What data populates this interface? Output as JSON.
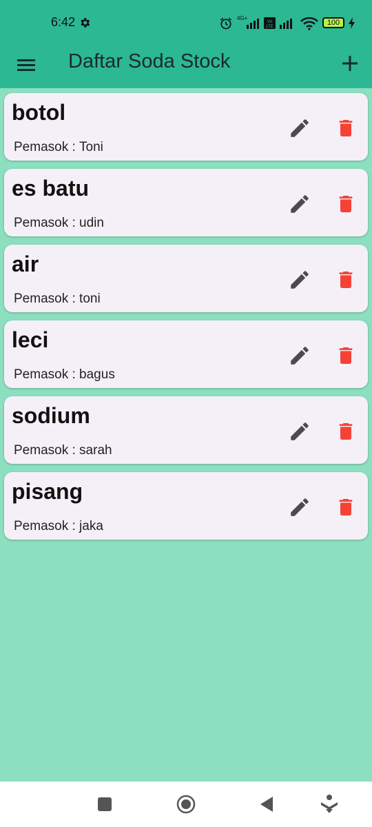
{
  "status": {
    "time": "6:42",
    "battery": "100",
    "network": "4G+"
  },
  "appbar": {
    "title": "Daftar Soda Stock"
  },
  "items": [
    {
      "name": "botol",
      "supplier_label": "Pemasok : ",
      "supplier": "Toni"
    },
    {
      "name": "es batu",
      "supplier_label": "Pemasok : ",
      "supplier": "udin"
    },
    {
      "name": "air",
      "supplier_label": "Pemasok : ",
      "supplier": "toni"
    },
    {
      "name": "leci",
      "supplier_label": "Pemasok : ",
      "supplier": "bagus"
    },
    {
      "name": "sodium",
      "supplier_label": "Pemasok : ",
      "supplier": "sarah"
    },
    {
      "name": "pisang",
      "supplier_label": "Pemasok : ",
      "supplier": "jaka"
    }
  ],
  "colors": {
    "appbar": "#2bb893",
    "background": "#8ce0c0",
    "card": "#f5f0f8",
    "delete": "#f44336",
    "edit": "#4a4a52"
  },
  "icons": {
    "menu": "menu-icon",
    "add": "plus-icon",
    "edit": "pencil-icon",
    "delete": "trash-icon"
  }
}
